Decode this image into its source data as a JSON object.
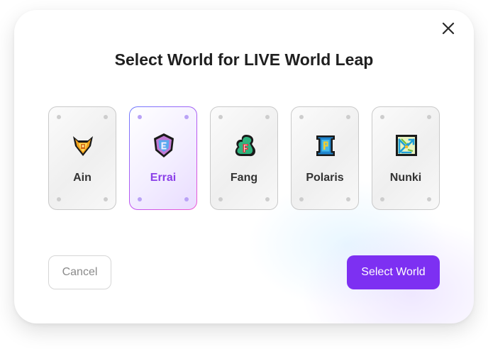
{
  "dialog": {
    "title": "Select World for LIVE World Leap",
    "close_icon": "close-icon"
  },
  "worlds": [
    {
      "name": "Ain",
      "icon": "ain-world-icon",
      "selected": false
    },
    {
      "name": "Errai",
      "icon": "errai-world-icon",
      "selected": true
    },
    {
      "name": "Fang",
      "icon": "fang-world-icon",
      "selected": false
    },
    {
      "name": "Polaris",
      "icon": "polaris-world-icon",
      "selected": false
    },
    {
      "name": "Nunki",
      "icon": "nunki-world-icon",
      "selected": false
    }
  ],
  "actions": {
    "cancel_label": "Cancel",
    "confirm_label": "Select World"
  },
  "colors": {
    "accent": "#7d30f2",
    "selected_text": "#8a3ee8",
    "title_text": "#1f1f1f"
  }
}
